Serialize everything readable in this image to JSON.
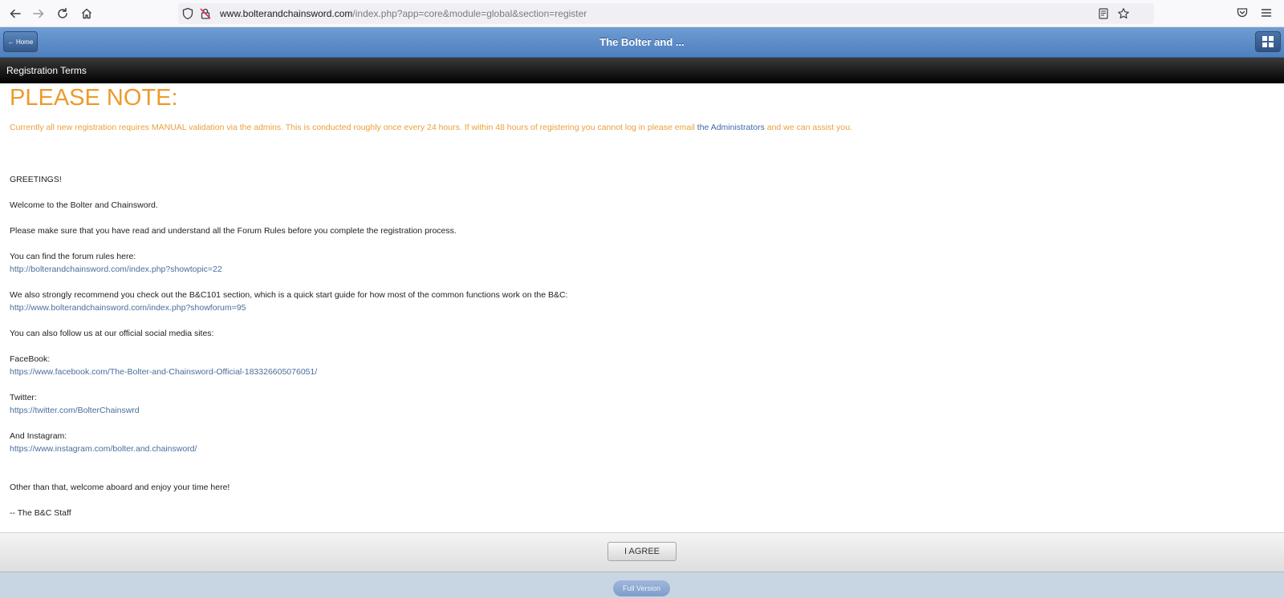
{
  "browser": {
    "url_host": "www.bolterandchainsword.com",
    "url_path": "/index.php?app=core&module=global&section=register",
    "icons": [
      "back-arrow-icon",
      "forward-arrow-icon",
      "reload-icon",
      "home-icon",
      "shield-icon",
      "lock-warning-icon",
      "reader-view-icon",
      "bookmark-star-icon",
      "pocket-icon",
      "menu-icon"
    ]
  },
  "header": {
    "home_label": "← Home",
    "title": "The Bolter and ...",
    "grid_icon": "grid-icon"
  },
  "section": {
    "title": "Registration Terms"
  },
  "notice": {
    "title": "PLEASE NOTE:",
    "text_before": "Currently all new registration requires MANUAL validation via the admins. This is conducted roughly once every 24 hours. If within 48 hours of registering you cannot log in please email ",
    "link_text": "the Administrators",
    "text_after": " and we can assist you."
  },
  "body": {
    "greeting": "GREETINGS!",
    "welcome": "Welcome to the Bolter and Chainsword.",
    "rules_prompt": "Please make sure that you have read and understand all the Forum Rules before you complete the registration process.",
    "rules_find": "You can find the forum rules here:",
    "rules_link": "http://bolterandchainsword.com/index.php?showtopic=22",
    "b101_text": "We also strongly recommend you check out the B&C101 section, which is a quick start guide for how most of the common functions work on the B&C:",
    "b101_link": "http://www.bolterandchainsword.com/index.php?showforum=95",
    "social_intro": "You can also follow us at our official social media sites:",
    "facebook_label": "FaceBook:",
    "facebook_link": "https://www.facebook.com/The-Bolter-and-Chainsword-Official-183326605076051/",
    "twitter_label": "Twitter:",
    "twitter_link": "https://twitter.com/BolterChainswrd",
    "instagram_label": "And Instagram:",
    "instagram_link": "https://www.instagram.com/bolter.and.chainsword/",
    "closing": "Other than that, welcome aboard and enjoy your time here!",
    "signature": "-- The B&C Staff"
  },
  "footer": {
    "agree_label": "I AGREE",
    "full_version_label": "Full Version"
  }
}
